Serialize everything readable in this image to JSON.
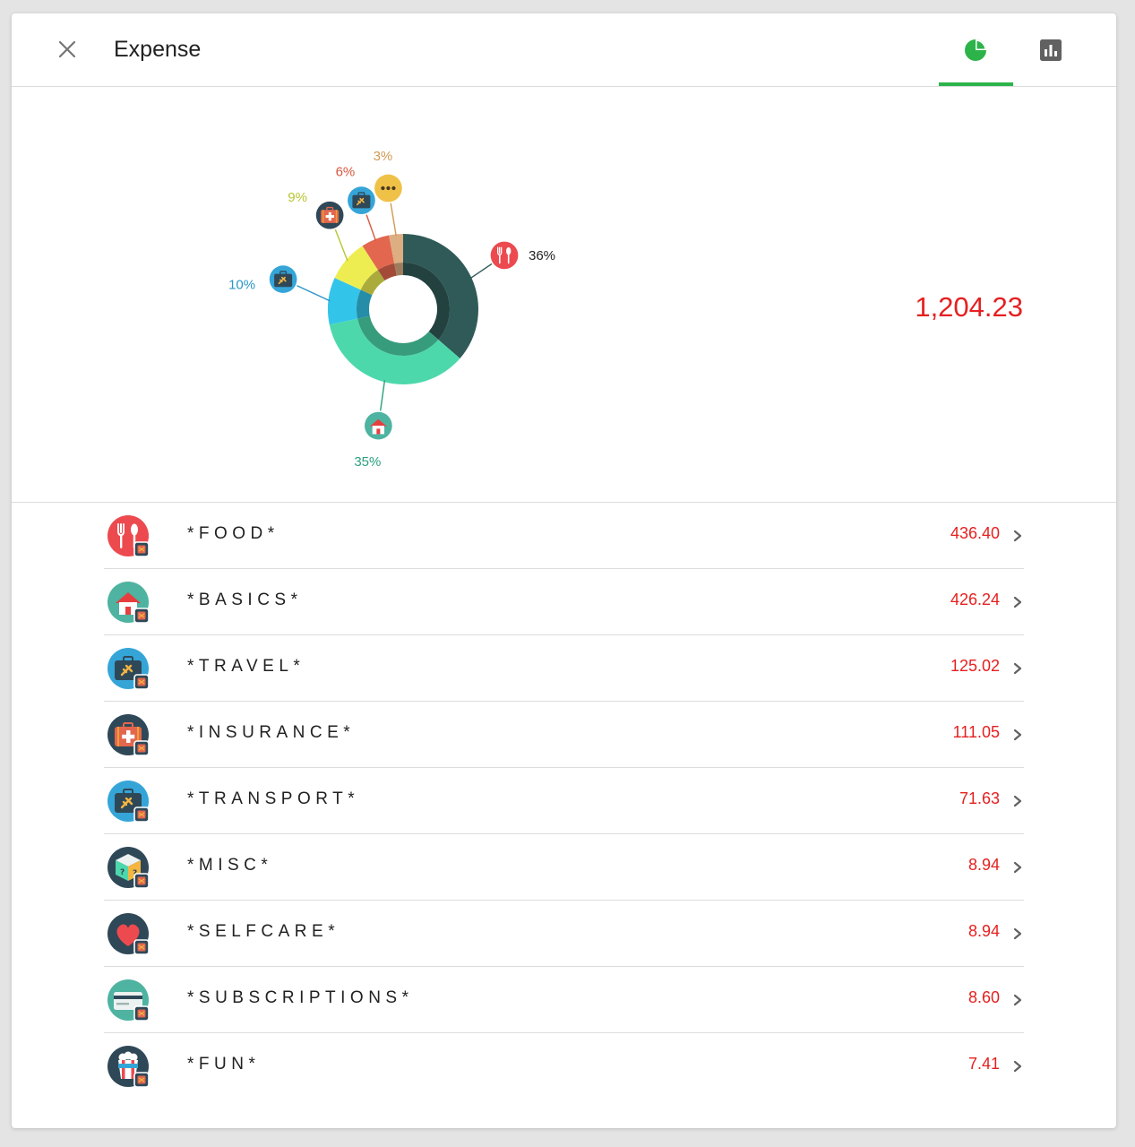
{
  "header": {
    "title": "Expense",
    "close_icon": "close-icon",
    "tabs": [
      {
        "icon": "pie-chart-icon",
        "active": true
      },
      {
        "icon": "bar-chart-icon",
        "active": false
      }
    ],
    "accent_color": "#2cb34a"
  },
  "summary": {
    "total": "1,204.23",
    "total_color": "#e52020"
  },
  "chart_data": {
    "type": "pie",
    "donut": true,
    "slices": [
      {
        "label": "36%",
        "value": 36,
        "color": "#2f5a57",
        "label_color": "#212121",
        "icon": "food-icon"
      },
      {
        "label": "35%",
        "value": 35,
        "color": "#4dd8ac",
        "label_color": "#2aa07e",
        "icon": "home-icon"
      },
      {
        "label": "10%",
        "value": 10,
        "color": "#33c4ea",
        "label_color": "#2a95c6",
        "icon": "travel-icon"
      },
      {
        "label": "9%",
        "value": 9,
        "color": "#eded52",
        "label_color": "#b8c530",
        "icon": "insurance-icon"
      },
      {
        "label": "6%",
        "value": 6,
        "color": "#e2674e",
        "label_color": "#d9573f",
        "icon": "transport-icon"
      },
      {
        "label": "3%",
        "value": 3,
        "color": "#dcae82",
        "label_color": "#d19a52",
        "icon": "more-icon"
      }
    ]
  },
  "categories": [
    {
      "label": "*FOOD*",
      "value": "436.40",
      "icon": "food-icon"
    },
    {
      "label": "*BASICS*",
      "value": "426.24",
      "icon": "home-icon"
    },
    {
      "label": "*TRAVEL*",
      "value": "125.02",
      "icon": "travel-icon"
    },
    {
      "label": "*INSURANCE*",
      "value": "111.05",
      "icon": "insurance-icon"
    },
    {
      "label": "*TRANSPORT*",
      "value": "71.63",
      "icon": "transport-icon"
    },
    {
      "label": "*MISC*",
      "value": "8.94",
      "icon": "misc-icon"
    },
    {
      "label": "*SELFCARE*",
      "value": "8.94",
      "icon": "selfcare-icon"
    },
    {
      "label": "*SUBSCRIPTIONS*",
      "value": "8.60",
      "icon": "subscriptions-icon"
    },
    {
      "label": "*FUN*",
      "value": "7.41",
      "icon": "fun-icon"
    }
  ]
}
